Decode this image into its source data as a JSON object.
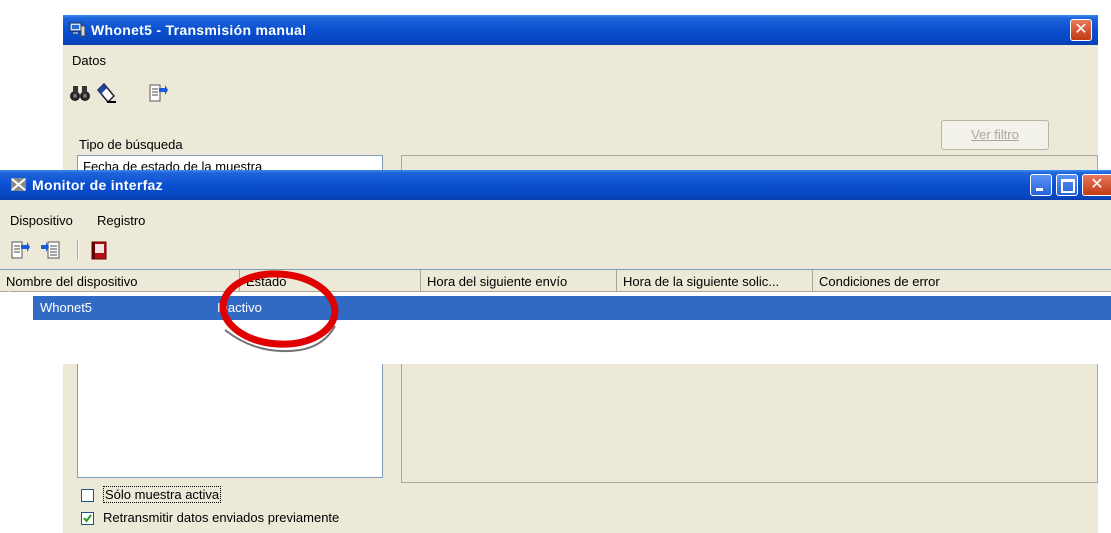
{
  "back_window": {
    "title": "Whonet5 - Transmisión manual",
    "menu": [
      "Datos"
    ],
    "toolbar_icons": [
      "binoculars-icon",
      "eraser-icon",
      "transmit-icon"
    ],
    "search_type_label": "Tipo de búsqueda",
    "search_type_value": "Fecha de estado de la muestra",
    "ver_filtro_label": "Ver filtro",
    "only_active_sample_label": "Sólo muestra activa",
    "only_active_sample_checked": false,
    "retransmit_label": "Retransmitir datos enviados previamente",
    "retransmit_checked": true
  },
  "front_window": {
    "title": "Monitor de interfaz",
    "menu": [
      "Dispositivo",
      "Registro"
    ],
    "toolbar_icons": [
      "send-icon",
      "receive-icon",
      "log-book-icon"
    ],
    "columns": [
      "Nombre del dispositivo",
      "Estado",
      "Hora del siguiente envío",
      "Hora de la siguiente solic...",
      "Condiciones de error"
    ],
    "rows": [
      {
        "device": "Whonet5",
        "status": "Inactivo",
        "next_send": "",
        "next_request": "",
        "errors": ""
      }
    ]
  },
  "colors": {
    "title_blue": "#0a4fd0",
    "selection_blue": "#316ac5",
    "annotation_red": "#e00000",
    "window_face": "#ece9d8"
  }
}
